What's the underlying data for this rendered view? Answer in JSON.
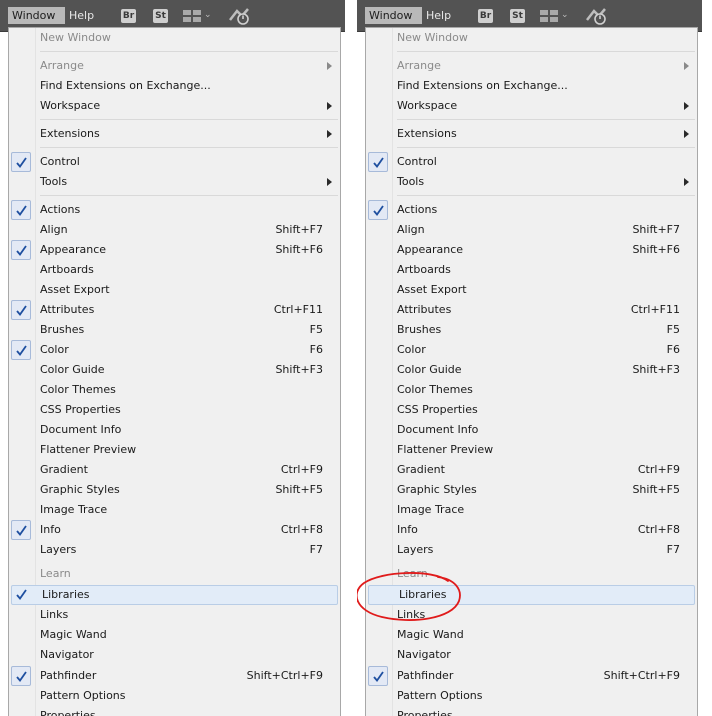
{
  "menubar": {
    "window_label": "Window",
    "help_label": "Help",
    "bridge_badge": "Br",
    "stock_badge": "St",
    "arrange_documents_icon": "grid-icon",
    "workspace_chevron_icon": "chevron-down-icon",
    "sync_icon": "sync-icon"
  },
  "colors": {
    "menubar_bg": "#535353",
    "menu_bg": "#f0f0f0",
    "highlight_bg": "#e2ecf8",
    "check_color": "#1e4fa0",
    "annotation_color": "#e01b1b"
  },
  "left_menu": {
    "items": [
      {
        "label": "New Window",
        "shortcut": "",
        "disabled": true
      },
      {
        "label": "Arrange",
        "shortcut": "",
        "disabled": true
      },
      {
        "label": "Find Extensions on Exchange...",
        "shortcut": ""
      },
      {
        "label": "Workspace",
        "shortcut": ""
      },
      {
        "label": "Extensions",
        "shortcut": ""
      },
      {
        "label": "Control",
        "shortcut": "",
        "checked": true
      },
      {
        "label": "Tools",
        "shortcut": ""
      },
      {
        "label": "Actions",
        "shortcut": "",
        "checked": true
      },
      {
        "label": "Align",
        "shortcut": "Shift+F7"
      },
      {
        "label": "Appearance",
        "shortcut": "Shift+F6",
        "checked": true
      },
      {
        "label": "Artboards",
        "shortcut": ""
      },
      {
        "label": "Asset Export",
        "shortcut": ""
      },
      {
        "label": "Attributes",
        "shortcut": "Ctrl+F11",
        "checked": true
      },
      {
        "label": "Brushes",
        "shortcut": "F5"
      },
      {
        "label": "Color",
        "shortcut": "F6",
        "checked": true
      },
      {
        "label": "Color Guide",
        "shortcut": "Shift+F3"
      },
      {
        "label": "Color Themes",
        "shortcut": ""
      },
      {
        "label": "CSS Properties",
        "shortcut": ""
      },
      {
        "label": "Document Info",
        "shortcut": ""
      },
      {
        "label": "Flattener Preview",
        "shortcut": ""
      },
      {
        "label": "Gradient",
        "shortcut": "Ctrl+F9"
      },
      {
        "label": "Graphic Styles",
        "shortcut": "Shift+F5"
      },
      {
        "label": "Image Trace",
        "shortcut": ""
      },
      {
        "label": "Info",
        "shortcut": "Ctrl+F8",
        "checked": true
      },
      {
        "label": "Layers",
        "shortcut": "F7"
      },
      {
        "label": "Learn",
        "shortcut": "",
        "disabled": true
      },
      {
        "label": "Libraries",
        "shortcut": "",
        "checked": true,
        "highlighted": true
      },
      {
        "label": "Links",
        "shortcut": ""
      },
      {
        "label": "Magic Wand",
        "shortcut": ""
      },
      {
        "label": "Navigator",
        "shortcut": ""
      },
      {
        "label": "Pathfinder",
        "shortcut": "Shift+Ctrl+F9",
        "checked": true
      },
      {
        "label": "Pattern Options",
        "shortcut": ""
      },
      {
        "label": "Properties",
        "shortcut": ""
      }
    ]
  },
  "right_menu": {
    "items": [
      {
        "label": "New Window",
        "shortcut": "",
        "disabled": true
      },
      {
        "label": "Arrange",
        "shortcut": "",
        "disabled": true
      },
      {
        "label": "Find Extensions on Exchange...",
        "shortcut": ""
      },
      {
        "label": "Workspace",
        "shortcut": ""
      },
      {
        "label": "Extensions",
        "shortcut": ""
      },
      {
        "label": "Control",
        "shortcut": "",
        "checked": true
      },
      {
        "label": "Tools",
        "shortcut": ""
      },
      {
        "label": "Actions",
        "shortcut": "",
        "checked": true
      },
      {
        "label": "Align",
        "shortcut": "Shift+F7"
      },
      {
        "label": "Appearance",
        "shortcut": "Shift+F6"
      },
      {
        "label": "Artboards",
        "shortcut": ""
      },
      {
        "label": "Asset Export",
        "shortcut": ""
      },
      {
        "label": "Attributes",
        "shortcut": "Ctrl+F11"
      },
      {
        "label": "Brushes",
        "shortcut": "F5"
      },
      {
        "label": "Color",
        "shortcut": "F6"
      },
      {
        "label": "Color Guide",
        "shortcut": "Shift+F3"
      },
      {
        "label": "Color Themes",
        "shortcut": ""
      },
      {
        "label": "CSS Properties",
        "shortcut": ""
      },
      {
        "label": "Document Info",
        "shortcut": ""
      },
      {
        "label": "Flattener Preview",
        "shortcut": ""
      },
      {
        "label": "Gradient",
        "shortcut": "Ctrl+F9"
      },
      {
        "label": "Graphic Styles",
        "shortcut": "Shift+F5"
      },
      {
        "label": "Image Trace",
        "shortcut": ""
      },
      {
        "label": "Info",
        "shortcut": "Ctrl+F8"
      },
      {
        "label": "Layers",
        "shortcut": "F7"
      },
      {
        "label": "Learn",
        "shortcut": "",
        "disabled": true
      },
      {
        "label": "Libraries",
        "shortcut": "",
        "highlighted": true
      },
      {
        "label": "Links",
        "shortcut": ""
      },
      {
        "label": "Magic Wand",
        "shortcut": ""
      },
      {
        "label": "Navigator",
        "shortcut": ""
      },
      {
        "label": "Pathfinder",
        "shortcut": "Shift+Ctrl+F9",
        "checked": true
      },
      {
        "label": "Pattern Options",
        "shortcut": ""
      },
      {
        "label": "Properties",
        "shortcut": ""
      }
    ]
  }
}
